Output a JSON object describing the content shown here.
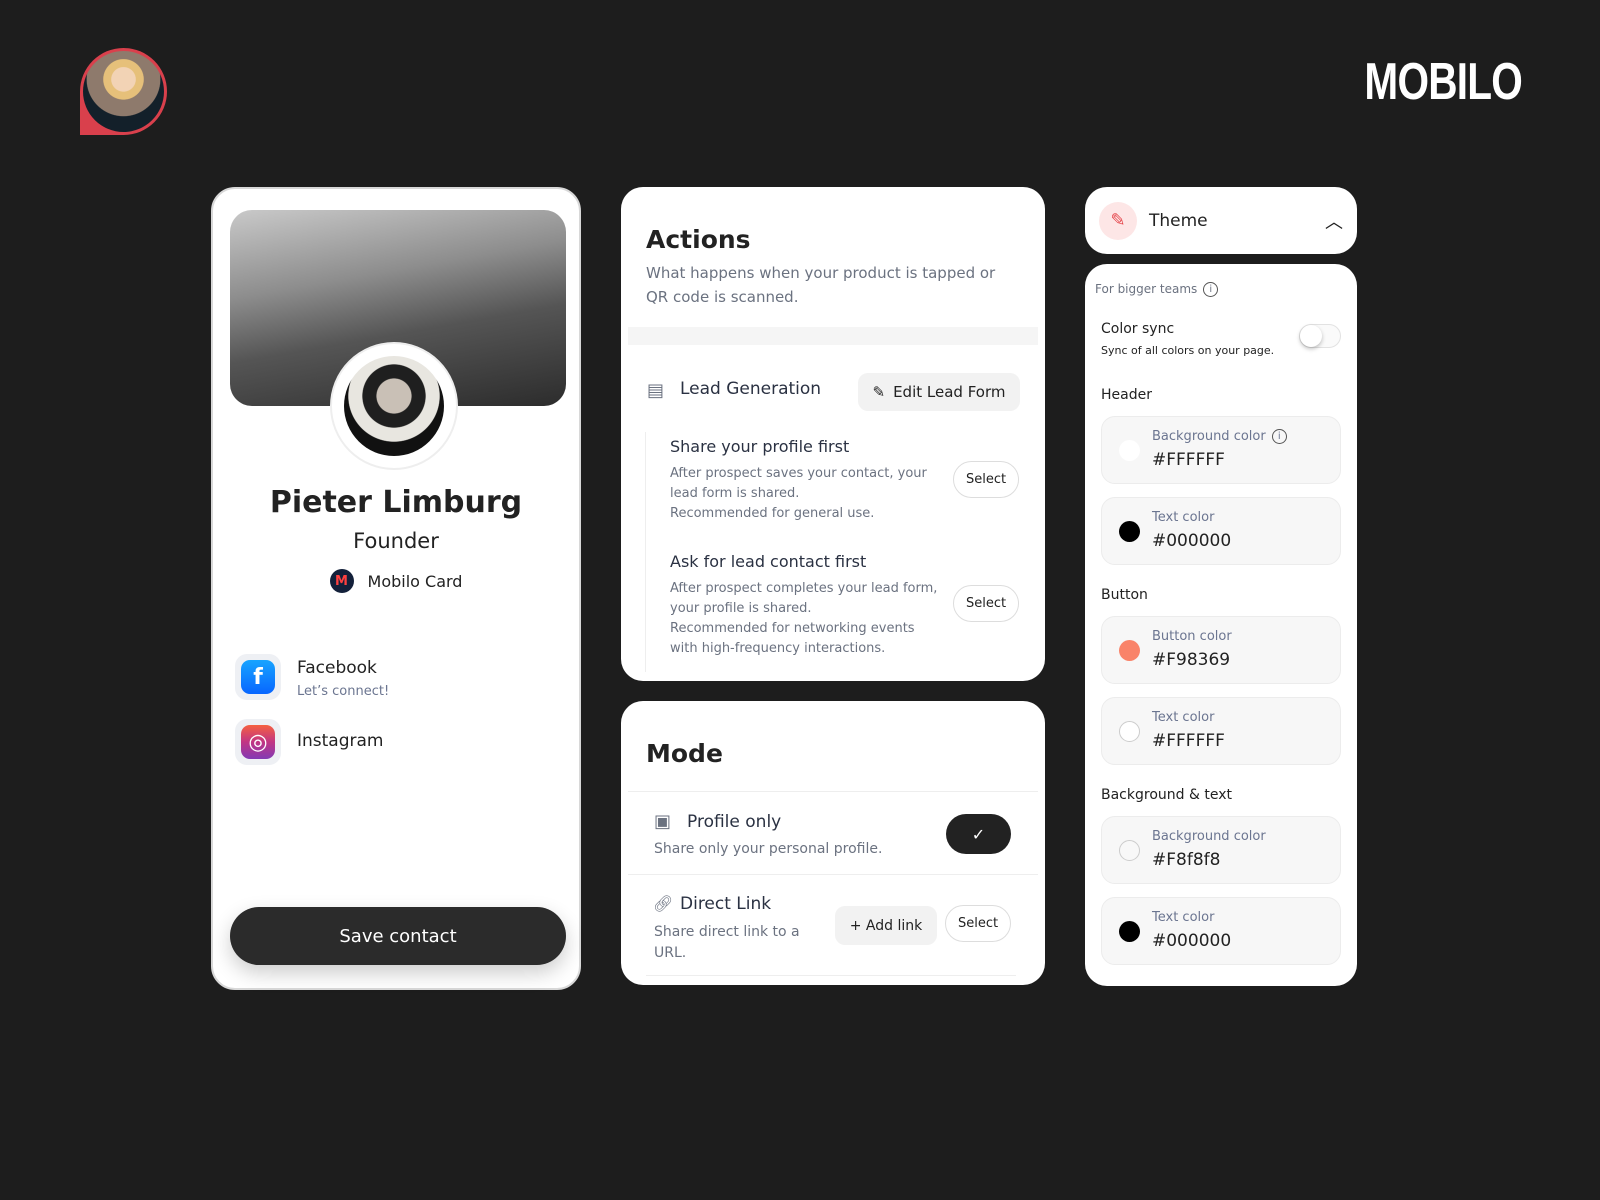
{
  "brand": {
    "logo": "MOBILO"
  },
  "profile": {
    "name": "Pieter Limburg",
    "role": "Founder",
    "company": "Mobilo Card",
    "company_logo": "M",
    "links": [
      {
        "title": "Facebook",
        "subtitle": "Let’s connect!",
        "icon": "facebook-icon"
      },
      {
        "title": "Instagram",
        "icon": "instagram-icon"
      }
    ],
    "save_label": "Save contact"
  },
  "actions": {
    "title": "Actions",
    "description": "What happens when your product is tapped or QR code is scanned.",
    "lead_title": "Lead Generation",
    "edit_label": "Edit Lead Form",
    "options": [
      {
        "title": "Share your profile first",
        "description": "After prospect saves your contact, your lead form is shared.\nRecommended for general use.",
        "button": "Select"
      },
      {
        "title": "Ask for lead contact first",
        "description": "After prospect completes your lead form, your profile is shared.\nRecommended for networking events with high-frequency interactions.",
        "button": "Select"
      }
    ]
  },
  "mode": {
    "title": "Mode",
    "profile_only": {
      "title": "Profile only",
      "description": "Share only your personal profile.",
      "selected": true
    },
    "direct_link": {
      "title": "Direct Link",
      "description": "Share direct link to a URL.",
      "add_label": "+ Add link",
      "button": "Select"
    }
  },
  "theme": {
    "title": "Theme",
    "expanded": true,
    "teams_label": "For bigger teams",
    "sync_title": "Color sync",
    "sync_desc": "Sync of all colors on your page.",
    "sync_on": false,
    "sections": [
      {
        "title": "Header",
        "fields": [
          {
            "label": "Background color",
            "value": "#FFFFFF"
          },
          {
            "label": "Text color",
            "value": "#000000"
          }
        ]
      },
      {
        "title": "Button",
        "fields": [
          {
            "label": "Button color",
            "value": "#F98369"
          },
          {
            "label": "Text color",
            "value": "#FFFFFF"
          }
        ]
      },
      {
        "title": "Background & text",
        "fields": [
          {
            "label": "Background color",
            "value": "#F8f8f8"
          },
          {
            "label": "Text color",
            "value": "#000000"
          }
        ]
      }
    ]
  }
}
